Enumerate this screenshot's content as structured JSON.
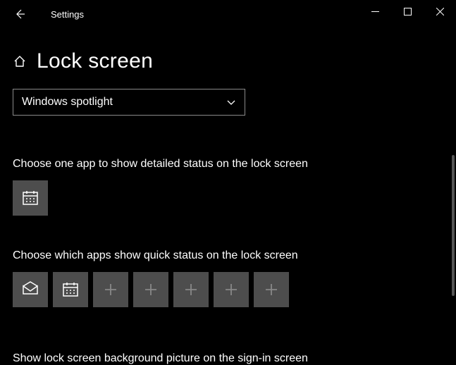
{
  "titlebar": {
    "app_title": "Settings"
  },
  "header": {
    "page_title": "Lock screen"
  },
  "dropdown": {
    "selected": "Windows spotlight"
  },
  "sections": {
    "detailed_label": "Choose one app to show detailed status on the lock screen",
    "quick_label": "Choose which apps show quick status on the lock screen",
    "signin_label": "Show lock screen background picture on the sign-in screen"
  },
  "detailed_apps": [
    {
      "icon": "calendar"
    }
  ],
  "quick_apps": [
    {
      "icon": "mail"
    },
    {
      "icon": "calendar"
    },
    {
      "icon": "plus"
    },
    {
      "icon": "plus"
    },
    {
      "icon": "plus"
    },
    {
      "icon": "plus"
    },
    {
      "icon": "plus"
    }
  ]
}
